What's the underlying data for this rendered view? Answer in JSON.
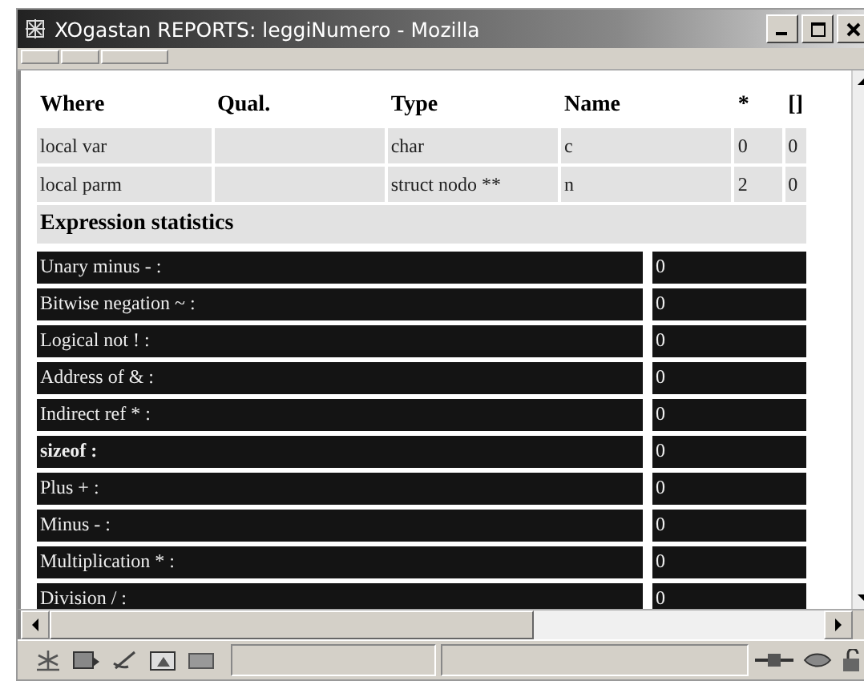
{
  "window": {
    "title": "XOgastan REPORTS: leggiNumero - Mozilla"
  },
  "symbols": {
    "columns": [
      "Where",
      "Qual.",
      "Type",
      "Name",
      "*",
      "[]"
    ],
    "rows": [
      [
        "local var",
        "",
        "char",
        "c",
        "0",
        "0"
      ],
      [
        "local parm",
        "",
        "struct nodo **",
        "n",
        "2",
        "0"
      ]
    ]
  },
  "section_title": "Expression statistics",
  "stats": [
    {
      "label": "Unary minus - :",
      "value": "0",
      "bold": false
    },
    {
      "label": "Bitwise negation ~ :",
      "value": "0",
      "bold": false
    },
    {
      "label": "Logical not ! :",
      "value": "0",
      "bold": false
    },
    {
      "label": "Address of & :",
      "value": "0",
      "bold": false
    },
    {
      "label": "Indirect ref * :",
      "value": "0",
      "bold": false
    },
    {
      "label": "sizeof :",
      "value": "0",
      "bold": true
    },
    {
      "label": "Plus + :",
      "value": "0",
      "bold": false
    },
    {
      "label": "Minus - :",
      "value": "0",
      "bold": false
    },
    {
      "label": "Multiplication * :",
      "value": "0",
      "bold": false
    },
    {
      "label": "Division / :",
      "value": "0",
      "bold": false
    }
  ]
}
